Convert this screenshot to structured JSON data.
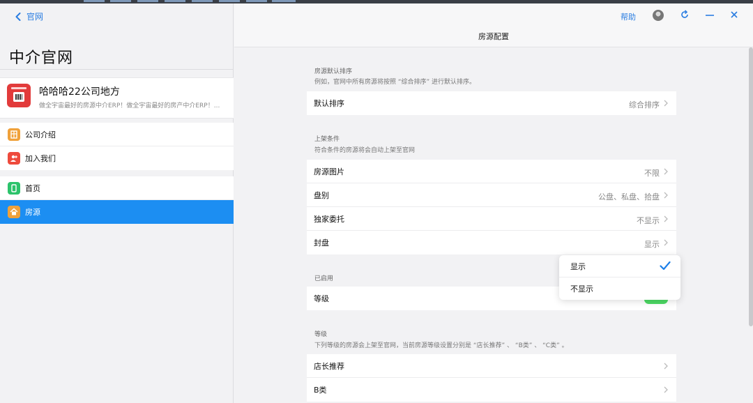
{
  "nav": {
    "back_label": "官网"
  },
  "left": {
    "title": "中介官网",
    "company": {
      "name": "哈哈哈22公司地方",
      "desc": "做全宇宙最好的房源中介ERP！做全宇宙最好的房产中介ERP！..."
    },
    "group1": [
      {
        "label": "公司介绍",
        "icon": "building-icon",
        "color": "#f0a13a"
      },
      {
        "label": "加入我们",
        "icon": "add-user-icon",
        "color": "#ee4a3c"
      }
    ],
    "group2": [
      {
        "label": "首页",
        "icon": "phone-icon",
        "color": "#2cc36b"
      },
      {
        "label": "房源",
        "icon": "home-icon",
        "color": "#f0a13a",
        "active": true
      }
    ]
  },
  "header": {
    "title": "房源配置",
    "help": "帮助"
  },
  "sections": {
    "sort": {
      "label": "房源默认排序",
      "sub": "例如，官网中所有房源将按照 “综合排序” 进行默认排序。",
      "rows": [
        {
          "label": "默认排序",
          "value": "综合排序"
        }
      ]
    },
    "conditions": {
      "label": "上架条件",
      "sub": "符合条件的房源将会自动上架至官网",
      "rows": [
        {
          "label": "房源图片",
          "value": "不限"
        },
        {
          "label": "盘别",
          "value": "公盘、私盘、拾盘"
        },
        {
          "label": "独家委托",
          "value": "不显示"
        },
        {
          "label": "封盘",
          "value": "显示"
        }
      ]
    },
    "enabled": {
      "label": "已启用",
      "rows": [
        {
          "label": "等级",
          "toggle_on": true
        }
      ]
    },
    "level": {
      "label": "等级",
      "sub": "下列等级的房源会上架至官网，当前房源等级设置分别是 “店长推荐” 、 “B类” 、 “C类” 。",
      "rows": [
        {
          "label": "店长推荐"
        },
        {
          "label": "B类"
        }
      ]
    }
  },
  "popup": {
    "options": [
      {
        "label": "显示",
        "selected": true
      },
      {
        "label": "不显示",
        "selected": false
      }
    ]
  },
  "colors": {
    "accent": "#1c8ef2",
    "link": "#2a7de1",
    "toggle": "#4cd964"
  }
}
